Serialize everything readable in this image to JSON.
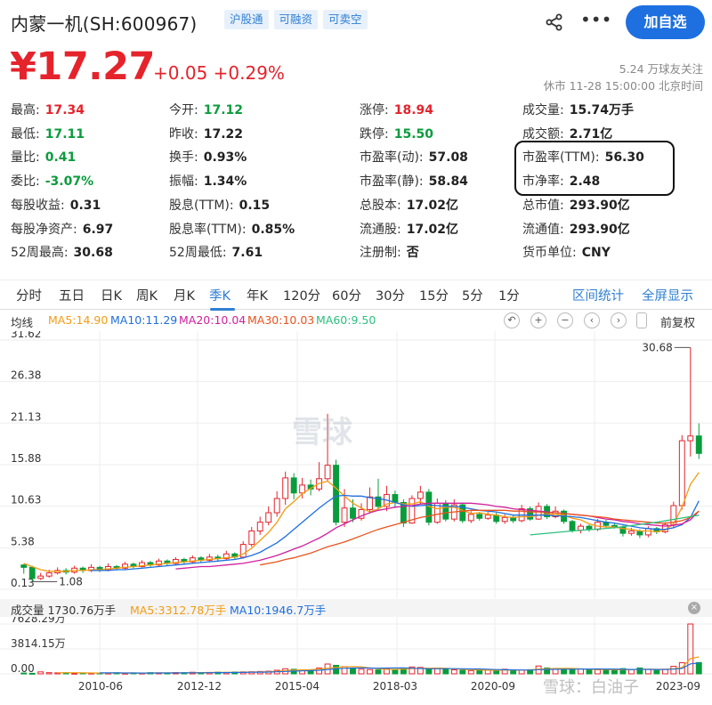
{
  "header": {
    "stock_name": "内蒙一机(SH:600967)",
    "tags": [
      "沪股通",
      "可融资",
      "可卖空"
    ],
    "follow_label": "加自选",
    "price": "¥17.27",
    "change": "+0.05 +0.29%",
    "followers": "5.24 万球友关注",
    "market_status": "休市 11-28 15:00:00 北京时间"
  },
  "quote": [
    {
      "label": "最高:",
      "value": "17.34",
      "color": "red"
    },
    {
      "label": "今开:",
      "value": "17.12",
      "color": "green"
    },
    {
      "label": "涨停:",
      "value": "18.94",
      "color": "red"
    },
    {
      "label": "成交量:",
      "value": "15.74万手",
      "color": ""
    },
    {
      "label": "最低:",
      "value": "17.11",
      "color": "green"
    },
    {
      "label": "昨收:",
      "value": "17.22",
      "color": ""
    },
    {
      "label": "跌停:",
      "value": "15.50",
      "color": "green"
    },
    {
      "label": "成交额:",
      "value": "2.71亿",
      "color": ""
    },
    {
      "label": "量比:",
      "value": "0.41",
      "color": "green"
    },
    {
      "label": "换手:",
      "value": "0.93%",
      "color": ""
    },
    {
      "label": "市盈率(动):",
      "value": "57.08",
      "color": ""
    },
    {
      "label": "市盈率(TTM):",
      "value": "56.30",
      "color": ""
    },
    {
      "label": "委比:",
      "value": "-3.07%",
      "color": "green"
    },
    {
      "label": "振幅:",
      "value": "1.34%",
      "color": ""
    },
    {
      "label": "市盈率(静):",
      "value": "58.84",
      "color": ""
    },
    {
      "label": "市净率:",
      "value": "2.48",
      "color": ""
    },
    {
      "label": "每股收益:",
      "value": "0.31",
      "color": ""
    },
    {
      "label": "股息(TTM):",
      "value": "0.15",
      "color": ""
    },
    {
      "label": "总股本:",
      "value": "17.02亿",
      "color": ""
    },
    {
      "label": "总市值:",
      "value": "293.90亿",
      "color": ""
    },
    {
      "label": "每股净资产:",
      "value": "6.97",
      "color": ""
    },
    {
      "label": "股息率(TTM):",
      "value": "0.85%",
      "color": ""
    },
    {
      "label": "流通股:",
      "value": "17.02亿",
      "color": ""
    },
    {
      "label": "流通值:",
      "value": "293.90亿",
      "color": ""
    },
    {
      "label": "52周最高:",
      "value": "30.68",
      "color": ""
    },
    {
      "label": "52周最低:",
      "value": "7.61",
      "color": ""
    },
    {
      "label": "注册制:",
      "value": "否",
      "color": ""
    },
    {
      "label": "货币单位:",
      "value": "CNY",
      "color": ""
    }
  ],
  "tabs": [
    "分时",
    "五日",
    "日K",
    "周K",
    "月K",
    "季K",
    "年K",
    "120分",
    "60分",
    "30分",
    "15分",
    "5分",
    "1分"
  ],
  "active_tab": "季K",
  "tab_links": [
    "区间统计",
    "全屏显示"
  ],
  "ma_legend": {
    "label": "均线",
    "items": [
      {
        "text": "MA5:14.90",
        "color": "#f39c12"
      },
      {
        "text": "MA10:11.29",
        "color": "#1e6fe0"
      },
      {
        "text": "MA20:10.04",
        "color": "#d0209e"
      },
      {
        "text": "MA30:10.03",
        "color": "#e8531f"
      },
      {
        "text": "MA60:9.50",
        "color": "#2cbf7e"
      }
    ],
    "fuquan": "前复权"
  },
  "volume_legend": {
    "label": "成交量 1730.76万手",
    "ma5": "MA5:3312.78万手",
    "ma10": "MA10:1946.7万手"
  },
  "watermark": "雪球",
  "watermark_corner": "雪球：白油子",
  "chart_data": {
    "type": "candlestick",
    "price_axis_ticks": [
      "31.62",
      "26.38",
      "21.13",
      "15.88",
      "10.63",
      "5.38",
      "0.13"
    ],
    "price_axis_values": [
      31.62,
      26.38,
      21.13,
      15.88,
      10.63,
      5.38,
      0.13
    ],
    "volume_axis_ticks": [
      "7628.29万",
      "3814.15万",
      "0.00"
    ],
    "volume_axis_values": [
      7628.29,
      3814.15,
      0
    ],
    "date_ticks": [
      "2010-06",
      "2012-12",
      "2015-04",
      "2018-03",
      "2020-09",
      "2023-09"
    ],
    "annotations": [
      {
        "label": "30.68",
        "kind": "high",
        "value": 30.68
      },
      {
        "label": "1.08",
        "kind": "low",
        "value": 1.08
      }
    ],
    "candles": [
      [
        3.2,
        2.9,
        3.3,
        2.1
      ],
      [
        2.9,
        1.5,
        3.1,
        1.1
      ],
      [
        1.5,
        1.8,
        2.2,
        1.3
      ],
      [
        1.8,
        2.2,
        2.6,
        1.6
      ],
      [
        2.2,
        2.5,
        2.9,
        2.0
      ],
      [
        2.5,
        2.3,
        2.8,
        2.0
      ],
      [
        2.3,
        2.8,
        3.1,
        2.1
      ],
      [
        2.8,
        2.5,
        3.0,
        2.2
      ],
      [
        2.5,
        2.9,
        3.3,
        2.3
      ],
      [
        2.9,
        2.6,
        3.1,
        2.3
      ],
      [
        2.6,
        3.0,
        3.4,
        2.4
      ],
      [
        3.0,
        2.8,
        3.2,
        2.5
      ],
      [
        2.8,
        3.3,
        3.6,
        2.6
      ],
      [
        3.3,
        3.0,
        3.5,
        2.8
      ],
      [
        3.0,
        3.5,
        3.8,
        2.9
      ],
      [
        3.5,
        3.2,
        3.7,
        3.0
      ],
      [
        3.2,
        3.7,
        4.0,
        3.0
      ],
      [
        3.7,
        3.4,
        3.9,
        3.1
      ],
      [
        3.4,
        3.9,
        4.2,
        3.2
      ],
      [
        3.9,
        3.6,
        4.1,
        3.3
      ],
      [
        3.6,
        4.1,
        4.4,
        3.4
      ],
      [
        4.1,
        3.8,
        4.3,
        3.5
      ],
      [
        3.8,
        4.2,
        4.6,
        3.6
      ],
      [
        4.2,
        4.0,
        4.5,
        3.7
      ],
      [
        4.0,
        4.6,
        5.0,
        3.8
      ],
      [
        4.6,
        4.2,
        4.8,
        3.9
      ],
      [
        4.2,
        5.8,
        6.2,
        4.0
      ],
      [
        5.8,
        7.5,
        8.0,
        5.5
      ],
      [
        7.5,
        8.6,
        9.3,
        7.0
      ],
      [
        8.6,
        9.8,
        10.6,
        8.2
      ],
      [
        9.8,
        11.6,
        12.5,
        9.3
      ],
      [
        11.6,
        14.2,
        15.0,
        10.8
      ],
      [
        14.2,
        12.3,
        14.8,
        11.5
      ],
      [
        12.3,
        13.3,
        14.2,
        11.6
      ],
      [
        13.3,
        12.8,
        14.0,
        12.0
      ],
      [
        12.8,
        14.1,
        16.2,
        12.5
      ],
      [
        14.1,
        15.8,
        22.3,
        13.8
      ],
      [
        15.8,
        8.6,
        16.5,
        8.2
      ],
      [
        8.6,
        10.4,
        12.8,
        8.0
      ],
      [
        10.4,
        9.1,
        11.5,
        8.6
      ],
      [
        9.1,
        10.2,
        11.0,
        8.8
      ],
      [
        10.2,
        11.8,
        13.0,
        9.7
      ],
      [
        11.8,
        10.6,
        14.1,
        10.1
      ],
      [
        10.6,
        12.1,
        13.2,
        10.0
      ],
      [
        12.1,
        11.1,
        12.6,
        10.4
      ],
      [
        11.1,
        8.5,
        11.5,
        8.0
      ],
      [
        8.5,
        11.6,
        12.0,
        8.4
      ],
      [
        11.6,
        12.4,
        13.2,
        10.9
      ],
      [
        12.4,
        8.6,
        12.8,
        8.2
      ],
      [
        8.6,
        11.0,
        11.6,
        8.4
      ],
      [
        11.0,
        9.0,
        11.4,
        8.7
      ],
      [
        9.0,
        10.8,
        11.5,
        8.7
      ],
      [
        10.8,
        8.8,
        11.1,
        8.5
      ],
      [
        8.8,
        9.6,
        10.0,
        8.5
      ],
      [
        9.6,
        9.1,
        9.9,
        8.8
      ],
      [
        9.1,
        9.5,
        9.9,
        8.9
      ],
      [
        9.5,
        8.7,
        9.8,
        8.4
      ],
      [
        8.7,
        9.2,
        9.6,
        8.4
      ],
      [
        9.2,
        8.8,
        9.4,
        8.5
      ],
      [
        8.8,
        10.3,
        10.8,
        8.6
      ],
      [
        10.3,
        9.0,
        10.6,
        8.8
      ],
      [
        9.0,
        10.6,
        11.1,
        8.9
      ],
      [
        10.6,
        9.3,
        10.9,
        9.0
      ],
      [
        9.3,
        10.0,
        10.6,
        9.1
      ],
      [
        10.0,
        8.7,
        10.2,
        8.4
      ],
      [
        8.7,
        7.6,
        8.9,
        7.3
      ],
      [
        7.6,
        8.1,
        8.4,
        7.2
      ],
      [
        8.1,
        7.7,
        8.3,
        7.4
      ],
      [
        7.7,
        8.6,
        9.0,
        7.5
      ],
      [
        8.6,
        8.2,
        8.9,
        7.9
      ],
      [
        8.2,
        8.0,
        8.5,
        7.8
      ],
      [
        8.0,
        7.2,
        8.2,
        6.8
      ],
      [
        7.2,
        7.5,
        7.9,
        6.9
      ],
      [
        7.5,
        7.0,
        7.7,
        6.6
      ],
      [
        7.0,
        7.8,
        8.1,
        6.7
      ],
      [
        7.8,
        7.4,
        8.0,
        7.1
      ],
      [
        7.4,
        8.3,
        8.6,
        7.2
      ],
      [
        8.3,
        10.7,
        11.2,
        7.9
      ],
      [
        10.7,
        18.9,
        19.6,
        10.2
      ],
      [
        18.9,
        19.5,
        30.7,
        16.9
      ],
      [
        19.5,
        17.3,
        21.1,
        16.6
      ]
    ],
    "volumes": [
      120,
      80,
      300,
      180,
      150,
      160,
      90,
      140,
      110,
      130,
      120,
      160,
      100,
      140,
      120,
      180,
      150,
      130,
      200,
      170,
      240,
      190,
      210,
      260,
      220,
      280,
      300,
      320,
      360,
      400,
      550,
      780,
      700,
      620,
      580,
      900,
      1500,
      1300,
      1100,
      800,
      700,
      650,
      600,
      750,
      680,
      900,
      1050,
      980,
      700,
      820,
      760,
      620,
      540,
      500,
      560,
      600,
      520,
      700,
      480,
      600,
      640,
      1200,
      900,
      760,
      650,
      700,
      760,
      600,
      620,
      580,
      560,
      800,
      650,
      900,
      700,
      520,
      700,
      1150,
      1700,
      7628,
      1730
    ],
    "ma_lines": [
      {
        "name": "MA5",
        "color": "#f39c12",
        "values": [
          3.4,
          3.0,
          2.6,
          2.4,
          2.4,
          2.4,
          2.5,
          2.5,
          2.6,
          2.6,
          2.7,
          2.8,
          2.9,
          3.0,
          3.1,
          3.2,
          3.3,
          3.4,
          3.5,
          3.6,
          3.7,
          3.8,
          3.9,
          4.0,
          4.1,
          4.2,
          4.6,
          5.3,
          6.3,
          7.3,
          8.6,
          10.3,
          11.2,
          12.2,
          12.9,
          13.5,
          13.8,
          12.9,
          11.9,
          11.0,
          10.4,
          9.9,
          10.3,
          10.9,
          11.1,
          10.9,
          10.9,
          11.2,
          10.6,
          10.3,
          10.5,
          10.5,
          10.1,
          9.7,
          9.8,
          9.6,
          9.5,
          9.3,
          9.2,
          9.3,
          9.3,
          9.5,
          9.6,
          9.6,
          9.5,
          9.1,
          8.9,
          8.4,
          8.1,
          8.0,
          8.0,
          7.8,
          7.7,
          7.5,
          7.5,
          7.4,
          7.6,
          8.4,
          10.5,
          13.4,
          14.9
        ]
      },
      {
        "name": "MA10",
        "color": "#1e6fe0",
        "values": [
          null,
          null,
          null,
          null,
          null,
          null,
          null,
          null,
          2.5,
          2.5,
          2.5,
          2.6,
          2.6,
          2.7,
          2.8,
          2.9,
          3.0,
          3.1,
          3.2,
          3.3,
          3.4,
          3.5,
          3.6,
          3.7,
          3.8,
          3.9,
          4.1,
          4.4,
          4.8,
          5.4,
          6.0,
          6.8,
          7.7,
          8.6,
          9.5,
          10.4,
          11.2,
          11.9,
          12.0,
          11.9,
          11.9,
          11.7,
          11.6,
          11.4,
          11.1,
          10.8,
          10.6,
          10.7,
          10.8,
          10.7,
          10.6,
          10.6,
          10.5,
          10.3,
          10.1,
          10.0,
          9.9,
          9.7,
          9.5,
          9.5,
          9.5,
          9.5,
          9.5,
          9.4,
          9.4,
          9.3,
          9.2,
          9.0,
          8.8,
          8.6,
          8.5,
          8.3,
          8.1,
          7.9,
          7.8,
          7.7,
          7.7,
          7.9,
          8.3,
          9.2,
          11.3
        ]
      },
      {
        "name": "MA20",
        "color": "#d0209e",
        "values": [
          null,
          null,
          null,
          null,
          null,
          null,
          null,
          null,
          null,
          null,
          null,
          null,
          null,
          null,
          null,
          null,
          null,
          null,
          2.7,
          2.8,
          2.9,
          3.0,
          3.0,
          3.1,
          3.2,
          3.3,
          3.4,
          3.6,
          3.8,
          4.1,
          4.4,
          4.8,
          5.2,
          5.6,
          6.1,
          6.6,
          7.2,
          7.9,
          8.4,
          8.9,
          9.4,
          9.8,
          10.1,
          10.3,
          10.5,
          10.6,
          10.7,
          10.9,
          11.0,
          11.0,
          11.0,
          11.0,
          11.0,
          11.0,
          10.9,
          10.8,
          10.6,
          10.5,
          10.3,
          10.2,
          10.1,
          10.0,
          9.9,
          9.8,
          9.7,
          9.6,
          9.5,
          9.4,
          9.2,
          9.0,
          8.9,
          8.7,
          8.6,
          8.4,
          8.3,
          8.2,
          8.1,
          8.2,
          8.4,
          8.9,
          10.0
        ]
      },
      {
        "name": "MA30",
        "color": "#e8531f",
        "values": [
          null,
          null,
          null,
          null,
          null,
          null,
          null,
          null,
          null,
          null,
          null,
          null,
          null,
          null,
          null,
          null,
          null,
          null,
          null,
          null,
          null,
          null,
          null,
          null,
          null,
          null,
          null,
          null,
          3.2,
          3.4,
          3.6,
          3.9,
          4.1,
          4.4,
          4.7,
          5.1,
          5.5,
          5.8,
          6.1,
          6.5,
          6.9,
          7.3,
          7.7,
          8.0,
          8.3,
          8.6,
          8.9,
          9.2,
          9.4,
          9.6,
          9.8,
          9.9,
          10.0,
          10.1,
          10.1,
          10.1,
          10.1,
          10.1,
          10.0,
          10.0,
          9.9,
          9.9,
          9.8,
          9.8,
          9.7,
          9.6,
          9.5,
          9.4,
          9.3,
          9.2,
          9.0,
          8.9,
          8.8,
          8.7,
          8.6,
          8.5,
          8.5,
          8.6,
          8.8,
          9.2,
          10.0
        ]
      },
      {
        "name": "MA60",
        "color": "#2cbf7e",
        "values": [
          null,
          null,
          null,
          null,
          null,
          null,
          null,
          null,
          null,
          null,
          null,
          null,
          null,
          null,
          null,
          null,
          null,
          null,
          null,
          null,
          null,
          null,
          null,
          null,
          null,
          null,
          null,
          null,
          null,
          null,
          null,
          null,
          null,
          null,
          null,
          null,
          null,
          null,
          null,
          null,
          null,
          null,
          null,
          null,
          null,
          null,
          null,
          null,
          null,
          null,
          null,
          null,
          null,
          null,
          null,
          null,
          null,
          null,
          null,
          null,
          null,
          null,
          null,
          null,
          null,
          null,
          null,
          null,
          null,
          null,
          null,
          null,
          null,
          null,
          null,
          null,
          null,
          null,
          null,
          null,
          null
        ]
      }
    ]
  }
}
